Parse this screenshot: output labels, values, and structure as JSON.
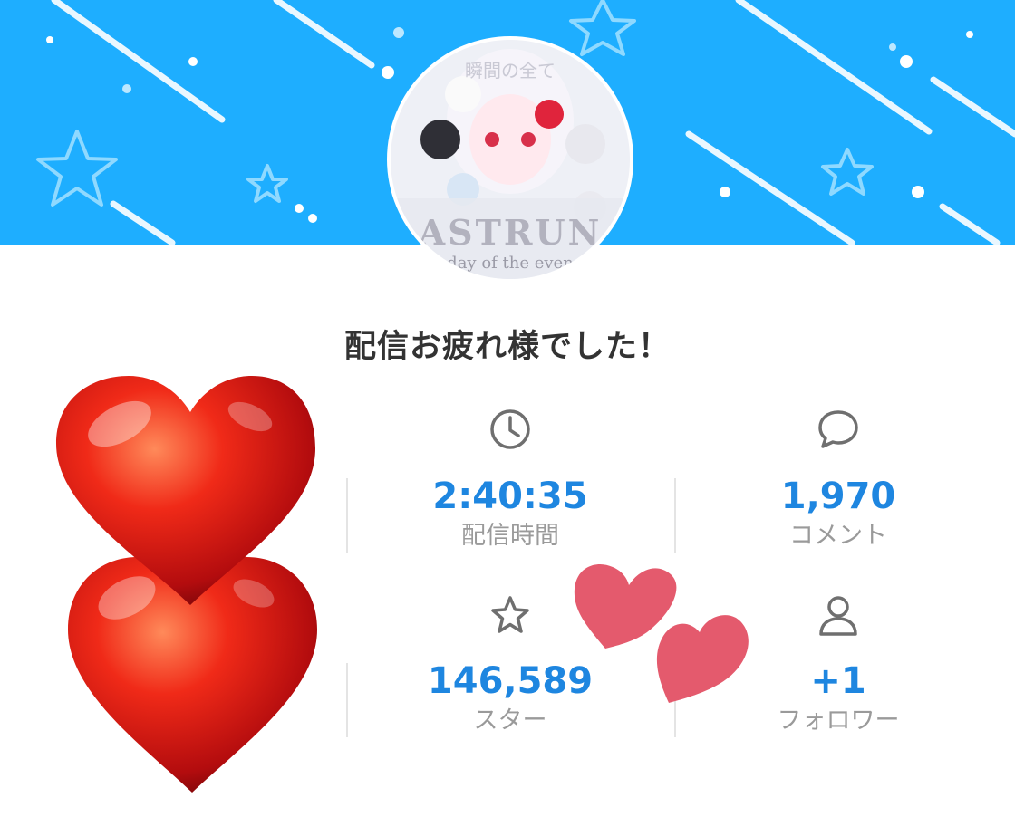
{
  "banner": {
    "color": "#1eaeff"
  },
  "avatar": {
    "top_text": "瞬間の全て",
    "logo_text": "ASTRUN",
    "tagline": "day of the even"
  },
  "title": "配信お疲れ様でした！",
  "stats": [
    {
      "icon": "clock-icon",
      "value": "2:40:35",
      "label": "配信時間"
    },
    {
      "icon": "comment-icon",
      "value": "1,970",
      "label": "コメント"
    },
    {
      "icon": "star-icon",
      "value": "146,589",
      "label": "スター"
    },
    {
      "icon": "person-icon",
      "value": "+1",
      "label": "フォロワー"
    }
  ],
  "colors": {
    "value": "#1e86e0",
    "label": "#9a9a9a",
    "title": "#333333",
    "big_heart": "#e8231c",
    "small_heart": "#e45a6d"
  }
}
